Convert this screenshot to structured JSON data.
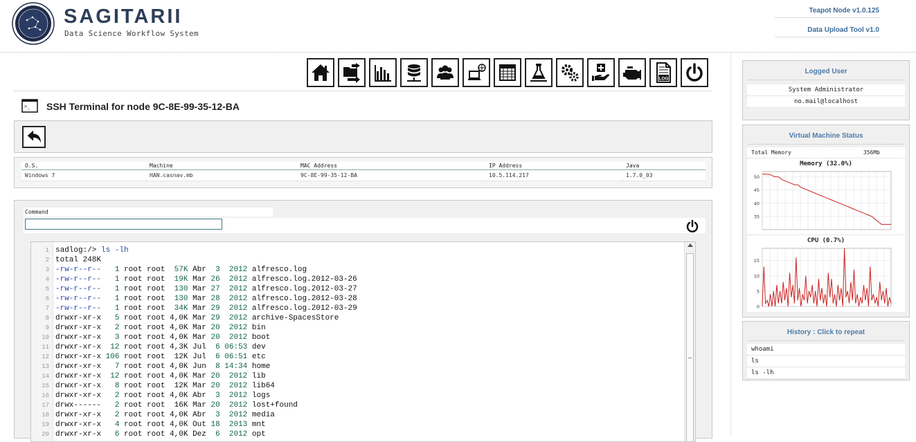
{
  "header": {
    "brand_title": "SAGITARII",
    "brand_subtitle": "Data Science Workflow System",
    "link_node": "Teapot Node v1.0.125",
    "link_upload": "Data Upload Tool v1.0"
  },
  "toolbar": {
    "icons": [
      "home-icon",
      "folder-transfer-icon",
      "bar-chart-icon",
      "database-icon",
      "users-icon",
      "network-terminal-icon",
      "table-icon",
      "experiment-icon",
      "gears-icon",
      "medical-hand-icon",
      "engine-icon",
      "log-file-icon",
      "power-icon"
    ],
    "log_icon_text": "LOG"
  },
  "page": {
    "title": "SSH Terminal for node 9C-8E-99-35-12-BA",
    "terminal_icon_text": ">_"
  },
  "node_info": {
    "headers": [
      "O.S.",
      "Machine",
      "MAC Address",
      "IP Address",
      "Java"
    ],
    "row": [
      "Windows 7",
      "HAN.casnav.mb",
      "9C-8E-99-35-12-BA",
      "10.5.114.217",
      "1.7.0_03"
    ]
  },
  "command": {
    "label": "Command",
    "value": ""
  },
  "terminal": {
    "prompt": "sadlog:/> ",
    "command": "ls -lh",
    "total": "total 248K",
    "entries": [
      {
        "perm": "-rw-r--r--",
        "links": "1",
        "owner": "root",
        "group": "root",
        "size": "57K",
        "month": "Abr",
        "day": "3",
        "time": "2012",
        "name": "alfresco.log",
        "link_color": true
      },
      {
        "perm": "-rw-r--r--",
        "links": "1",
        "owner": "root",
        "group": "root",
        "size": "19K",
        "month": "Mar",
        "day": "26",
        "time": "2012",
        "name": "alfresco.log.2012-03-26",
        "link_color": true
      },
      {
        "perm": "-rw-r--r--",
        "links": "1",
        "owner": "root",
        "group": "root",
        "size": "130",
        "month": "Mar",
        "day": "27",
        "time": "2012",
        "name": "alfresco.log.2012-03-27",
        "link_color": true
      },
      {
        "perm": "-rw-r--r--",
        "links": "1",
        "owner": "root",
        "group": "root",
        "size": "130",
        "month": "Mar",
        "day": "28",
        "time": "2012",
        "name": "alfresco.log.2012-03-28",
        "link_color": true
      },
      {
        "perm": "-rw-r--r--",
        "links": "1",
        "owner": "root",
        "group": "root",
        "size": "34K",
        "month": "Mar",
        "day": "29",
        "time": "2012",
        "name": "alfresco.log.2012-03-29",
        "link_color": true
      },
      {
        "perm": "drwxr-xr-x",
        "links": "5",
        "owner": "root",
        "group": "root",
        "size": "4,0K",
        "month": "Mar",
        "day": "29",
        "time": "2012",
        "name": "archive-SpacesStore",
        "link_color": false
      },
      {
        "perm": "drwxr-xr-x",
        "links": "2",
        "owner": "root",
        "group": "root",
        "size": "4,0K",
        "month": "Mar",
        "day": "20",
        "time": "2012",
        "name": "bin",
        "link_color": false
      },
      {
        "perm": "drwxr-xr-x",
        "links": "3",
        "owner": "root",
        "group": "root",
        "size": "4,0K",
        "month": "Mar",
        "day": "20",
        "time": "2012",
        "name": "boot",
        "link_color": false
      },
      {
        "perm": "drwxr-xr-x",
        "links": "12",
        "owner": "root",
        "group": "root",
        "size": "4,3K",
        "month": "Jul",
        "day": "6",
        "time": "06:53",
        "name": "dev",
        "link_color": false
      },
      {
        "perm": "drwxr-xr-x",
        "links": "106",
        "owner": "root",
        "group": "root",
        "size": "12K",
        "month": "Jul",
        "day": "6",
        "time": "06:51",
        "name": "etc",
        "link_color": false
      },
      {
        "perm": "drwxr-xr-x",
        "links": "7",
        "owner": "root",
        "group": "root",
        "size": "4,0K",
        "month": "Jun",
        "day": "8",
        "time": "14:34",
        "name": "home",
        "link_color": false
      },
      {
        "perm": "drwxr-xr-x",
        "links": "12",
        "owner": "root",
        "group": "root",
        "size": "4,0K",
        "month": "Mar",
        "day": "20",
        "time": "2012",
        "name": "lib",
        "link_color": false
      },
      {
        "perm": "drwxr-xr-x",
        "links": "8",
        "owner": "root",
        "group": "root",
        "size": "12K",
        "month": "Mar",
        "day": "20",
        "time": "2012",
        "name": "lib64",
        "link_color": false
      },
      {
        "perm": "drwxr-xr-x",
        "links": "2",
        "owner": "root",
        "group": "root",
        "size": "4,0K",
        "month": "Abr",
        "day": "3",
        "time": "2012",
        "name": "logs",
        "link_color": false
      },
      {
        "perm": "drwx------",
        "links": "2",
        "owner": "root",
        "group": "root",
        "size": "16K",
        "month": "Mar",
        "day": "20",
        "time": "2012",
        "name": "lost+found",
        "link_color": false
      },
      {
        "perm": "drwxr-xr-x",
        "links": "2",
        "owner": "root",
        "group": "root",
        "size": "4,0K",
        "month": "Abr",
        "day": "3",
        "time": "2012",
        "name": "media",
        "link_color": false
      },
      {
        "perm": "drwxr-xr-x",
        "links": "4",
        "owner": "root",
        "group": "root",
        "size": "4,0K",
        "month": "Out",
        "day": "18",
        "time": "2013",
        "name": "mnt",
        "link_color": false
      },
      {
        "perm": "drwxr-xr-x",
        "links": "6",
        "owner": "root",
        "group": "root",
        "size": "4,0K",
        "month": "Dez",
        "day": "6",
        "time": "2012",
        "name": "opt",
        "link_color": false
      }
    ]
  },
  "logged_user": {
    "title": "Logged User",
    "name": "System Administrator",
    "email": "no.mail@localhost"
  },
  "vm_status": {
    "title": "Virtual Machine Status",
    "total_memory_label": "Total Memory",
    "total_memory_value": "356Mb"
  },
  "chart_data": [
    {
      "type": "line",
      "title": "Memory (32.0%)",
      "ylim": [
        30,
        52
      ],
      "yticks": [
        35,
        40,
        45,
        50
      ],
      "color": "#cc2222",
      "values": [
        51,
        51,
        51,
        50.5,
        50,
        50,
        49,
        48.5,
        48,
        47.5,
        47,
        47,
        46,
        45.5,
        45,
        44.5,
        44,
        43.5,
        43,
        42.5,
        42,
        41.5,
        41,
        40.5,
        40,
        39.5,
        39,
        38.5,
        38,
        37.5,
        37,
        36.5,
        36,
        35.5,
        35,
        34,
        33,
        32,
        32,
        32,
        32
      ]
    },
    {
      "type": "line",
      "title": "CPU (0.7%)",
      "ylim": [
        0,
        19
      ],
      "yticks": [
        0,
        5,
        10,
        15
      ],
      "color": "#cc2222",
      "values": [
        0,
        13,
        1,
        2,
        0,
        4,
        0,
        5,
        0,
        7,
        1,
        5,
        1,
        8,
        2,
        6,
        0,
        11,
        3,
        7,
        1,
        16,
        2,
        6,
        0,
        4,
        2,
        10,
        1,
        5,
        3,
        7,
        1,
        5,
        0,
        9,
        2,
        6,
        1,
        4,
        0,
        11,
        3,
        9,
        1,
        4,
        0,
        7,
        2,
        6,
        0,
        19,
        3,
        5,
        1,
        8,
        2,
        12,
        1,
        4,
        0,
        3,
        1,
        7,
        2,
        6,
        0,
        13,
        2,
        4,
        1,
        3,
        0,
        8,
        2,
        5,
        1,
        6,
        0,
        3,
        1
      ]
    }
  ],
  "history": {
    "title": "History : Click to repeat",
    "items": [
      "whoami",
      "ls",
      "ls -lh"
    ]
  }
}
